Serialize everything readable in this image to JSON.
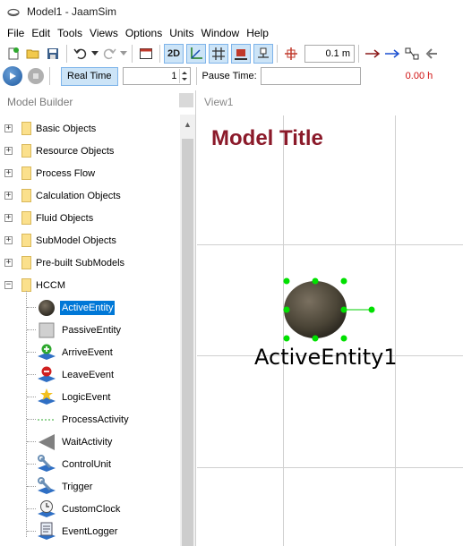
{
  "window": {
    "title": "Model1 - JaamSim"
  },
  "menu": [
    "File",
    "Edit",
    "Tools",
    "Views",
    "Options",
    "Units",
    "Window",
    "Help"
  ],
  "toolbar": {
    "view_2d_label": "2D",
    "grid_length": "0.1  m"
  },
  "run_bar": {
    "real_time_label": "Real Time",
    "speed_value": "1",
    "pause_time_label": "Pause Time:",
    "pause_time_value": "",
    "sim_time": "0.00  h"
  },
  "model_builder": {
    "title": "Model Builder",
    "categories": [
      "Basic Objects",
      "Resource Objects",
      "Process Flow",
      "Calculation Objects",
      "Fluid Objects",
      "SubModel Objects",
      "Pre-built SubModels",
      "HCCM"
    ],
    "hccm_items": [
      {
        "label": "ActiveEntity",
        "icon": "sphere-icon",
        "selected": true
      },
      {
        "label": "PassiveEntity",
        "icon": "square-icon",
        "selected": false
      },
      {
        "label": "ArriveEvent",
        "icon": "arrive-event-icon",
        "selected": false
      },
      {
        "label": "LeaveEvent",
        "icon": "leave-event-icon",
        "selected": false
      },
      {
        "label": "LogicEvent",
        "icon": "logic-event-icon",
        "selected": false
      },
      {
        "label": "ProcessActivity",
        "icon": "dashed-line-icon",
        "selected": false
      },
      {
        "label": "WaitActivity",
        "icon": "triangle-icon",
        "selected": false
      },
      {
        "label": "ControlUnit",
        "icon": "wrench-icon",
        "selected": false
      },
      {
        "label": "Trigger",
        "icon": "wrench-icon",
        "selected": false
      },
      {
        "label": "CustomClock",
        "icon": "clock-icon",
        "selected": false
      },
      {
        "label": "EventLogger",
        "icon": "logger-icon",
        "selected": false
      }
    ]
  },
  "view": {
    "tab_label": "View1",
    "model_title": "Model Title",
    "entity_label": "ActiveEntity1"
  },
  "colors": {
    "model_title": "#8b1a2a",
    "selection": "#0078d7",
    "clock": "#d01010",
    "handle": "#00e000"
  }
}
